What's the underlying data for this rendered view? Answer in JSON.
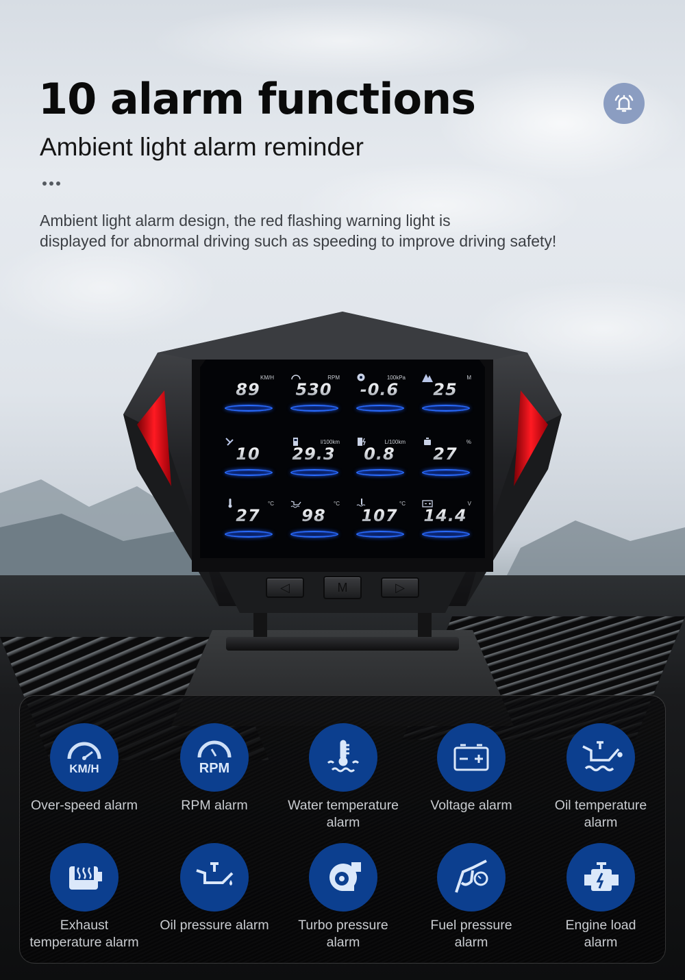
{
  "header": {
    "title": "10 alarm functions",
    "subtitle": "Ambient light alarm reminder",
    "description_lines": [
      "Ambient light alarm design, the red flashing warning light is",
      "displayed for abnormal driving such as speeding to improve driving safety!"
    ],
    "badge_icon": "bell-icon"
  },
  "colors": {
    "accent_blue": "#0c3f8f",
    "badge_blue": "#8b9dc1",
    "warning_red": "#e3151e",
    "screen_ring": "#2a6cff"
  },
  "device": {
    "screen": {
      "gauges": [
        {
          "icon": "speedometer-icon",
          "unit": "KM/H",
          "value": "89"
        },
        {
          "icon": "rpm-gauge-icon",
          "unit": "RPM",
          "value": "530"
        },
        {
          "icon": "turbo-icon",
          "unit": "100kPa",
          "value": "-0.6"
        },
        {
          "icon": "altitude-mountain-icon",
          "unit": "M",
          "value": "25"
        },
        {
          "icon": "satellite-icon",
          "unit": "",
          "value": "10"
        },
        {
          "icon": "fuel-pump-icon",
          "unit": "l/100km",
          "value": "29.3"
        },
        {
          "icon": "fuel-electric-icon",
          "unit": "L/100km",
          "value": "0.8"
        },
        {
          "icon": "engine-icon",
          "unit": "%",
          "value": "27"
        },
        {
          "icon": "thermometer-icon",
          "unit": "°C",
          "value": "27"
        },
        {
          "icon": "oil-temperature-icon",
          "unit": "°C",
          "value": "98"
        },
        {
          "icon": "water-temperature-icon",
          "unit": "°C",
          "value": "107"
        },
        {
          "icon": "battery-icon",
          "unit": "V",
          "value": "14.4"
        }
      ]
    },
    "buttons": [
      {
        "name": "previous",
        "label": "◁"
      },
      {
        "name": "mode",
        "label": "M"
      },
      {
        "name": "next",
        "label": "▷"
      }
    ]
  },
  "alarms": [
    {
      "icon": "kmh-speedometer-icon",
      "icon_text": "KM/H",
      "label_lines": [
        "Over-speed alarm"
      ]
    },
    {
      "icon": "rpm-gauge-icon",
      "icon_text": "RPM",
      "label_lines": [
        "RPM alarm"
      ]
    },
    {
      "icon": "water-temperature-icon",
      "icon_text": "",
      "label_lines": [
        "Water temperature",
        "alarm"
      ]
    },
    {
      "icon": "battery-icon",
      "icon_text": "",
      "label_lines": [
        "Voltage alarm"
      ]
    },
    {
      "icon": "oil-temperature-icon",
      "icon_text": "",
      "label_lines": [
        "Oil temperature",
        "alarm"
      ]
    },
    {
      "icon": "exhaust-heater-icon",
      "icon_text": "",
      "label_lines": [
        "Exhaust",
        "temperature alarm"
      ]
    },
    {
      "icon": "oil-can-icon",
      "icon_text": "",
      "label_lines": [
        "Oil pressure alarm"
      ]
    },
    {
      "icon": "turbo-icon",
      "icon_text": "",
      "label_lines": [
        "Turbo pressure",
        "alarm"
      ]
    },
    {
      "icon": "fuel-nozzle-icon",
      "icon_text": "",
      "label_lines": [
        "Fuel pressure",
        "alarm"
      ]
    },
    {
      "icon": "engine-icon",
      "icon_text": "",
      "label_lines": [
        "Engine load",
        "alarm"
      ]
    }
  ]
}
